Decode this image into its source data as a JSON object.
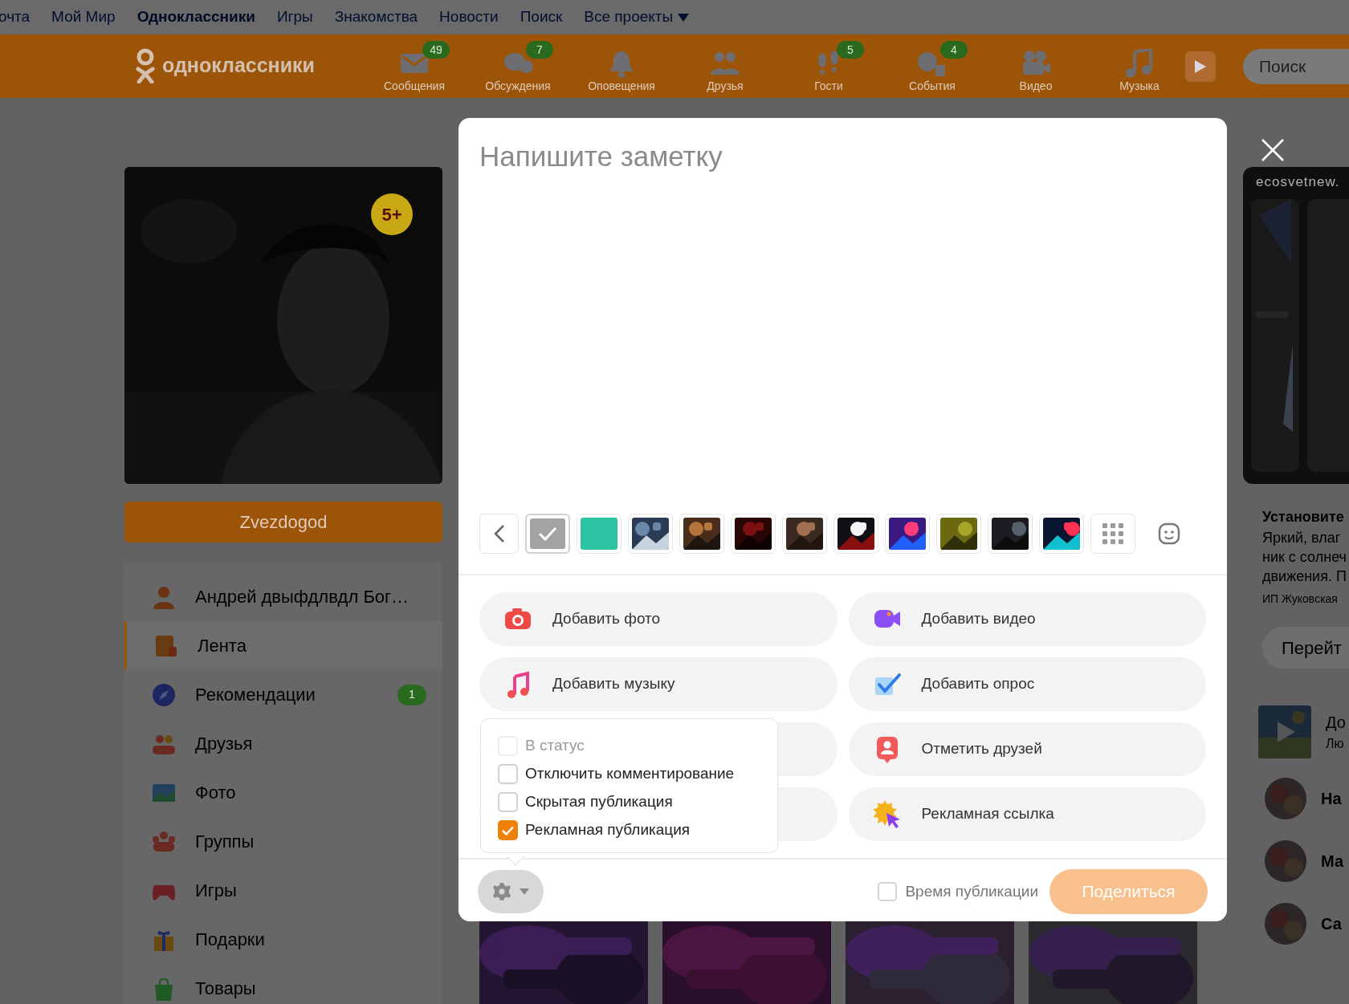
{
  "top_links": [
    {
      "label": "очта",
      "selected": false,
      "has_menu": false
    },
    {
      "label": "Мой Мир",
      "selected": false,
      "has_menu": false
    },
    {
      "label": "Одноклассники",
      "selected": true,
      "has_menu": false
    },
    {
      "label": "Игры",
      "selected": false,
      "has_menu": false
    },
    {
      "label": "Знакомства",
      "selected": false,
      "has_menu": false
    },
    {
      "label": "Новости",
      "selected": false,
      "has_menu": false
    },
    {
      "label": "Поиск",
      "selected": false,
      "has_menu": false
    },
    {
      "label": "Все проекты",
      "selected": false,
      "has_menu": true
    }
  ],
  "header": {
    "logo_text": "одноклассники",
    "nav": [
      {
        "kind": "messages",
        "label": "Сообщения",
        "badge": "49"
      },
      {
        "kind": "discussions",
        "label": "Обсуждения",
        "badge": "7"
      },
      {
        "kind": "notifications",
        "label": "Оповещения"
      },
      {
        "kind": "friends",
        "label": "Друзья"
      },
      {
        "kind": "guests",
        "label": "Гости",
        "badge": "5"
      },
      {
        "kind": "events",
        "label": "События",
        "badge": "4"
      },
      {
        "kind": "video",
        "label": "Видео"
      },
      {
        "kind": "music",
        "label": "Музыка"
      }
    ],
    "search": {
      "placeholder": "Поиск"
    }
  },
  "profile": {
    "badge": "5+",
    "name": "Zvezdogod"
  },
  "sidebar": {
    "items": [
      {
        "kind": "user",
        "label": "Андрей двыфдлвдл Бог…",
        "selected": false
      },
      {
        "kind": "feed",
        "label": "Лента",
        "selected": true
      },
      {
        "kind": "recommendations",
        "label": "Рекомендации",
        "selected": false,
        "badge": "1"
      },
      {
        "kind": "friends",
        "label": "Друзья",
        "selected": false
      },
      {
        "label": "Фото",
        "selected": false
      },
      {
        "kind": "groups",
        "label": "Группы",
        "selected": false
      },
      {
        "kind": "games",
        "label": "Игры",
        "selected": false
      },
      {
        "kind": "gifts",
        "label": "Подарки",
        "selected": false
      },
      {
        "kind": "goods",
        "label": "Товары",
        "selected": false
      }
    ]
  },
  "composer": {
    "placeholder": "Напишите заметку",
    "backgrounds": [
      {
        "kind": "color",
        "color": "#a3a3a3",
        "selected": true
      },
      {
        "kind": "color",
        "color": "#2dc4a4",
        "selected": false
      },
      {
        "kind": "picture",
        "selected": false
      },
      {
        "kind": "picture",
        "selected": false
      },
      {
        "kind": "picture",
        "selected": false
      },
      {
        "kind": "picture",
        "selected": false
      },
      {
        "kind": "picture",
        "selected": false
      },
      {
        "kind": "picture",
        "selected": false
      },
      {
        "kind": "picture",
        "selected": false
      },
      {
        "kind": "picture",
        "selected": false
      },
      {
        "kind": "picture",
        "selected": false
      }
    ],
    "actions": [
      {
        "label": "Добавить фото"
      },
      {
        "kind": "video",
        "label": "Добавить видео"
      },
      {
        "kind": "music",
        "label": "Добавить музыку"
      },
      {
        "kind": "poll",
        "label": "Добавить опрос"
      },
      {
        "kind": "covered"
      },
      {
        "kind": "friends",
        "label": "Отметить друзей"
      },
      {
        "kind": "covered"
      },
      {
        "kind": "ad_link",
        "label": "Рекламная ссылка"
      }
    ],
    "options": [
      {
        "label": "В статус",
        "checked": false,
        "disabled": true
      },
      {
        "label": "Отключить комментирование",
        "checked": false,
        "disabled": false
      },
      {
        "label": "Скрытая публикация",
        "checked": false,
        "disabled": false
      },
      {
        "label": "Рекламная публикация",
        "checked": true,
        "disabled": false
      }
    ],
    "schedule": {
      "label": "Время публикации",
      "checked": false
    },
    "share": {
      "label": "Поделиться",
      "disabled": true
    }
  },
  "right_ad": {
    "domain": "ecosvetnew.",
    "title": "Установите",
    "lines": [
      "Яркий, влаг",
      "ник с солнеч",
      "движения. П"
    ],
    "advertiser": "ИП Жуковская",
    "button": "Перейт"
  },
  "right_list": [
    {
      "kind": "video",
      "title": "До",
      "subtitle": "Лю"
    },
    {
      "kind": "avatar",
      "title": "На"
    },
    {
      "kind": "avatar",
      "title": "Ма"
    },
    {
      "kind": "avatar",
      "title": "Са"
    }
  ]
}
